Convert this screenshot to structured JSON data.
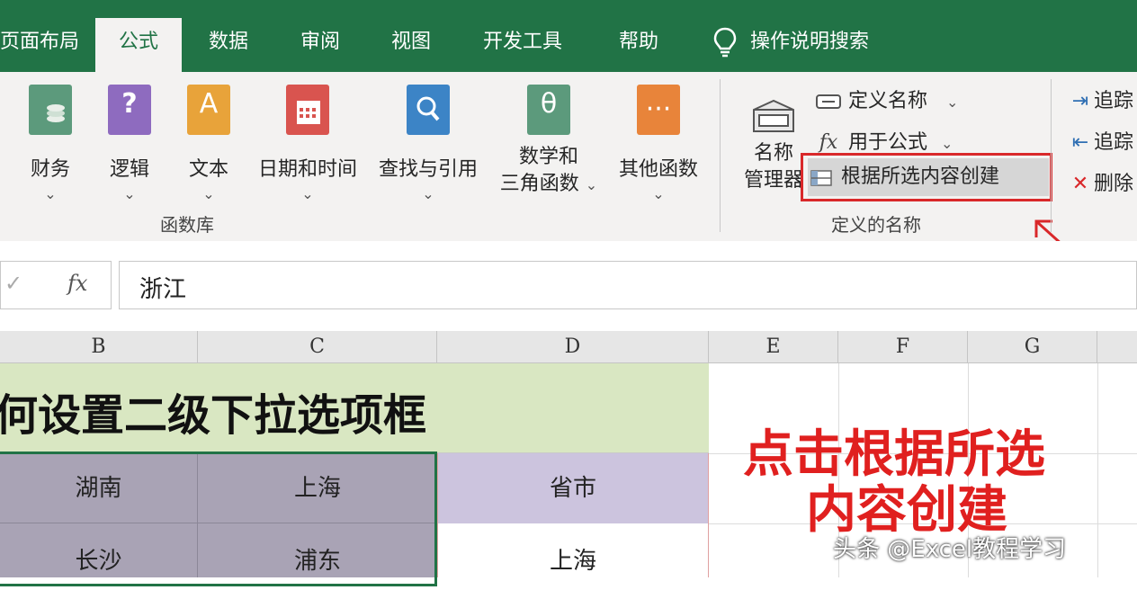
{
  "tabs": [
    {
      "label": "页面布局"
    },
    {
      "label": "公式"
    },
    {
      "label": "数据"
    },
    {
      "label": "审阅"
    },
    {
      "label": "视图"
    },
    {
      "label": "开发工具"
    },
    {
      "label": "帮助"
    }
  ],
  "tell_me": "操作说明搜索",
  "function_library": {
    "buttons": [
      {
        "label": "财务",
        "color": "#5c9a7c"
      },
      {
        "label": "逻辑",
        "color": "#8e6bbf"
      },
      {
        "label": "文本",
        "color": "#e8a33a"
      },
      {
        "label": "日期和时间",
        "color": "#d9544f"
      },
      {
        "label": "查找与引用",
        "color": "#3c84c6"
      },
      {
        "label": "数学和",
        "label2": "三角函数",
        "color": "#5c9a7c"
      },
      {
        "label": "其他函数",
        "color": "#e8843a"
      }
    ],
    "group_label": "函数库"
  },
  "defined_names": {
    "manager_label1": "名称",
    "manager_label2": "管理器",
    "define_name": "定义名称",
    "use_in_formula": "用于公式",
    "create_from_selection": "根据所选内容创建",
    "group_label": "定义的名称",
    "highlight_color": "#d9282a"
  },
  "formula_auditing": {
    "trace1": "追踪",
    "trace2": "追踪",
    "remove": "删除"
  },
  "formula_bar": {
    "fx": "fx",
    "value": "浙江"
  },
  "columns": [
    "B",
    "C",
    "D",
    "E",
    "F",
    "G"
  ],
  "sheet": {
    "title": "何设置二级下拉选项框",
    "row1": {
      "b": "湖南",
      "c": "上海",
      "d": "省市"
    },
    "row2": {
      "b": "长沙",
      "c": "浦东",
      "d": "上海"
    }
  },
  "annotation": {
    "line1": "点击根据所选",
    "line2": "内容创建",
    "color": "#e0201f"
  },
  "watermark": "头条 @Excel教程学习"
}
